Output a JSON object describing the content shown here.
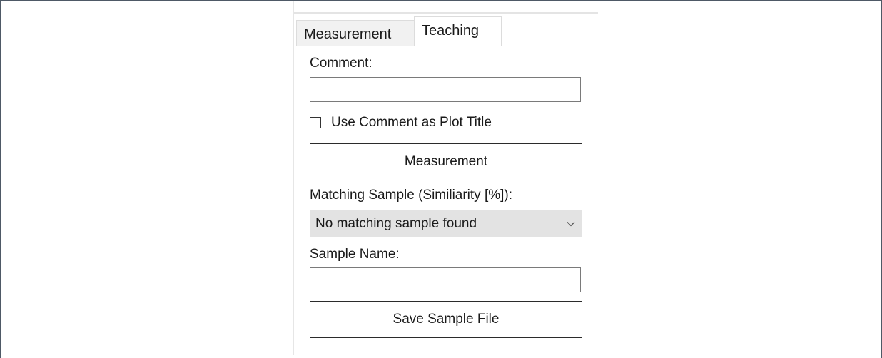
{
  "tabs": [
    {
      "label": "Measurement",
      "active": false
    },
    {
      "label": "Teaching",
      "active": true
    }
  ],
  "form": {
    "comment_label": "Comment:",
    "comment_value": "",
    "use_comment_label": "Use Comment as Plot Title",
    "use_comment_checked": false,
    "measurement_button": "Measurement",
    "matching_label": "Matching Sample (Similiarity [%]):",
    "matching_selected": "No matching sample found",
    "sample_name_label": "Sample Name:",
    "sample_name_value": "",
    "save_button": "Save Sample File"
  },
  "icons": {
    "dropdown": "chevron-down-icon"
  },
  "colors": {
    "frame_border": "#4e5966",
    "combo_background": "#e3e3e3",
    "button_border": "#2b2b2b"
  }
}
